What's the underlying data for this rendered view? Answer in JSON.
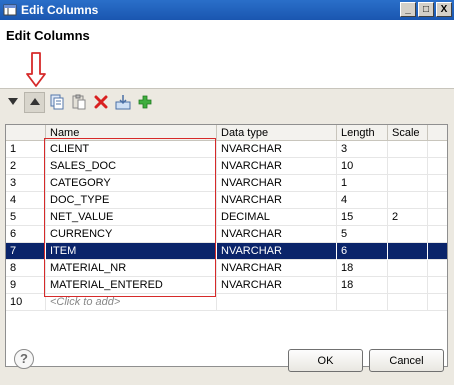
{
  "window": {
    "title": "Edit Columns",
    "controls": [
      "_",
      "□",
      "X"
    ]
  },
  "header": {
    "heading": "Edit Columns"
  },
  "toolbar": {
    "buttons": [
      {
        "name": "move-down",
        "icon": "triangle-down-icon"
      },
      {
        "name": "move-up",
        "icon": "triangle-up-icon"
      },
      {
        "name": "copy",
        "icon": "copy-icon"
      },
      {
        "name": "paste",
        "icon": "paste-icon"
      },
      {
        "name": "delete",
        "icon": "red-x-icon"
      },
      {
        "name": "import",
        "icon": "import-icon"
      },
      {
        "name": "add",
        "icon": "green-plus-icon"
      }
    ]
  },
  "table": {
    "headers": [
      "",
      "Name",
      "Data type",
      "Length",
      "Scale"
    ],
    "rows": [
      [
        "1",
        "CLIENT",
        "NVARCHAR",
        "3",
        ""
      ],
      [
        "2",
        "SALES_DOC",
        "NVARCHAR",
        "10",
        ""
      ],
      [
        "3",
        "CATEGORY",
        "NVARCHAR",
        "1",
        ""
      ],
      [
        "4",
        "DOC_TYPE",
        "NVARCHAR",
        "4",
        ""
      ],
      [
        "5",
        "NET_VALUE",
        "DECIMAL",
        "15",
        "2"
      ],
      [
        "6",
        "CURRENCY",
        "NVARCHAR",
        "5",
        ""
      ],
      [
        "7",
        "ITEM",
        "NVARCHAR",
        "6",
        ""
      ],
      [
        "8",
        "MATERIAL_NR",
        "NVARCHAR",
        "18",
        ""
      ],
      [
        "9",
        "MATERIAL_ENTERED",
        "NVARCHAR",
        "18",
        ""
      ],
      [
        "10",
        "<Click to add>",
        "",
        "",
        ""
      ]
    ],
    "selected_row": 7
  },
  "footer": {
    "ok": "OK",
    "cancel": "Cancel",
    "help": "?"
  },
  "colors": {
    "titlebar": "#1a56b0",
    "selection": "#0a246a",
    "annotation": "#d62a2a"
  }
}
